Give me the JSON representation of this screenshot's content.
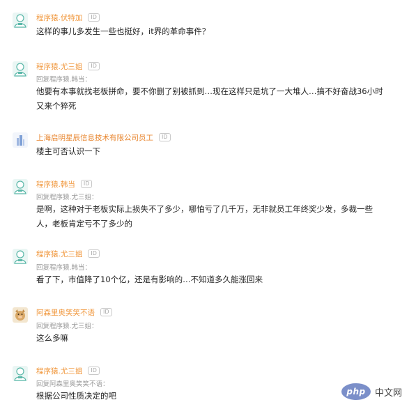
{
  "id_badge": "ID",
  "comments": [
    {
      "author": "程序猿.伏特加",
      "text": "这样的事儿多发生一些也挺好，it界的革命事件？"
    },
    {
      "author": "程序猿.尤三姐",
      "reply_to": "回复程序猿.韩当：",
      "text_lines": [
        "他要有本事就找老板拼命，要不你删了别被抓到…现在这样只是坑了一大堆人…搞不好奋战36小时",
        "又来个猝死"
      ]
    },
    {
      "author": "上海启明星辰信息技术有限公司员工",
      "text": "楼主可否认识一下"
    },
    {
      "author": "程序猿.韩当",
      "reply_to": "回复程序猿.尤三姐：",
      "text_lines": [
        "是啊，这种对于老板实际上损失不了多少，哪怕亏了几千万，无非就员工年终奖少发，多裁一些",
        "人，老板肯定亏不了多少的"
      ]
    },
    {
      "author": "程序猿.尤三姐",
      "reply_to": "回复程序猿.韩当：",
      "text": "看了下，市值降了10个亿，还是有影响的…不知道多久能涨回来"
    },
    {
      "author": "阿森里奥笑笑不语",
      "reply_to": "回复程序猿.尤三姐：",
      "text": "这么多嘛"
    },
    {
      "author": "程序猿.尤三姐",
      "reply_to": "回复阿森里奥笑笑不语：",
      "text": "根据公司性质决定的吧"
    }
  ],
  "watermark": {
    "logo": "php",
    "text": "中文网"
  },
  "colors": {
    "author": "#f0963a",
    "reply": "#9a9a9a",
    "text": "#222222"
  }
}
